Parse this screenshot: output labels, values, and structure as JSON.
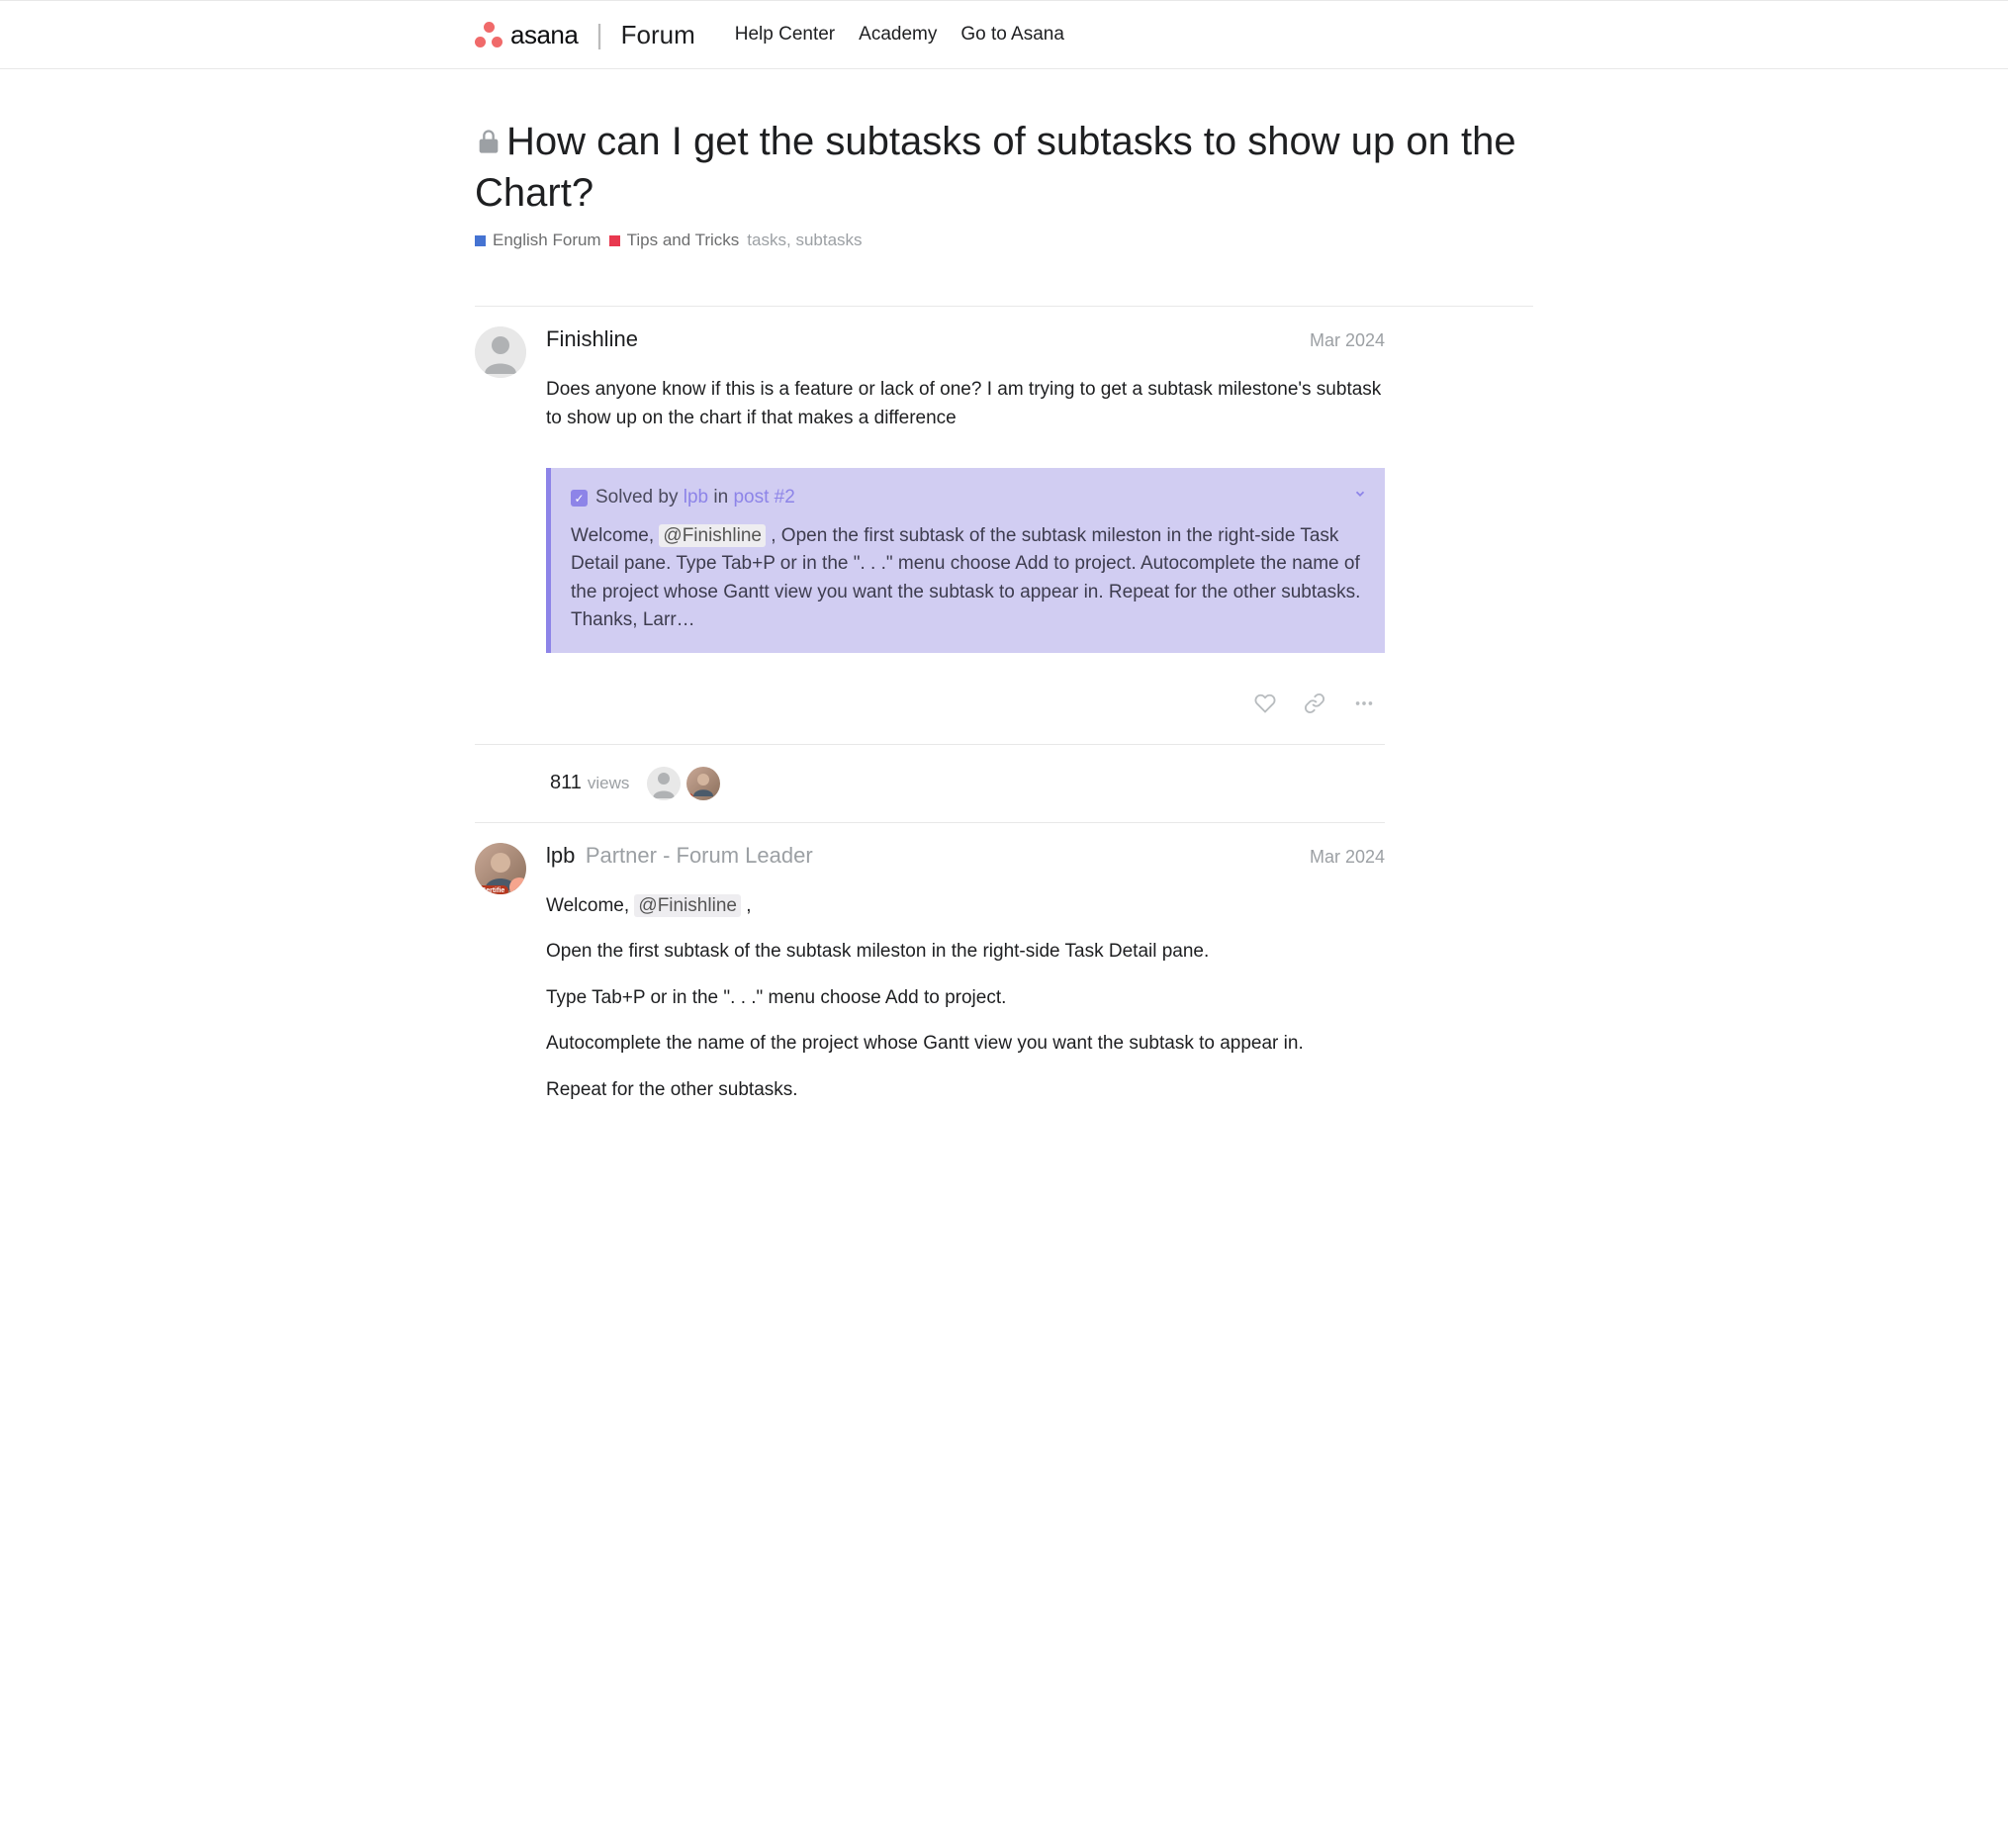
{
  "header": {
    "brand": "asana",
    "forum": "Forum",
    "nav": {
      "help": "Help Center",
      "academy": "Academy",
      "goto": "Go to Asana"
    }
  },
  "topic": {
    "title": "How can I get the subtasks of subtasks to show up on the Chart?",
    "categories": {
      "cat1": {
        "label": "English Forum",
        "color": "#4573d2"
      },
      "cat2": {
        "label": "Tips and Tricks",
        "color": "#e8384f"
      }
    },
    "tags": {
      "tag1": "tasks",
      "tag2": "subtasks"
    }
  },
  "posts": {
    "p1": {
      "author": "Finishline",
      "date": "Mar 2024",
      "body": "Does anyone know if this is a feature or lack of one? I am trying to get a subtask milestone's subtask to show up on the chart if that makes a difference",
      "solved": {
        "prefix": "Solved by ",
        "solver": "lpb",
        "in": " in ",
        "link": "post #2",
        "welcome": "Welcome, ",
        "mention": "@Finishline",
        "rest": " , Open the first subtask of the subtask mileston in the right-side Task Detail pane. Type Tab+P or in the \". . .\" menu choose Add to project. Autocomplete the name of the project whose Gantt view you want the subtask to appear in. Repeat for the other subtasks. Thanks, Larr…"
      }
    },
    "p2": {
      "author": "lpb",
      "title": "Partner - Forum Leader",
      "date": "Mar 2024",
      "welcome": "Welcome, ",
      "mention": "@Finishline",
      "comma": " ,",
      "line1": "Open the first subtask of the subtask mileston in the right-side Task Detail pane.",
      "line2": "Type Tab+P or in the \". . .\" menu choose Add to project.",
      "line3": "Autocomplete the name of the project whose Gantt view you want the subtask to appear in.",
      "line4": "Repeat for the other subtasks."
    }
  },
  "stats": {
    "views": "811",
    "viewsLabel": "views"
  }
}
